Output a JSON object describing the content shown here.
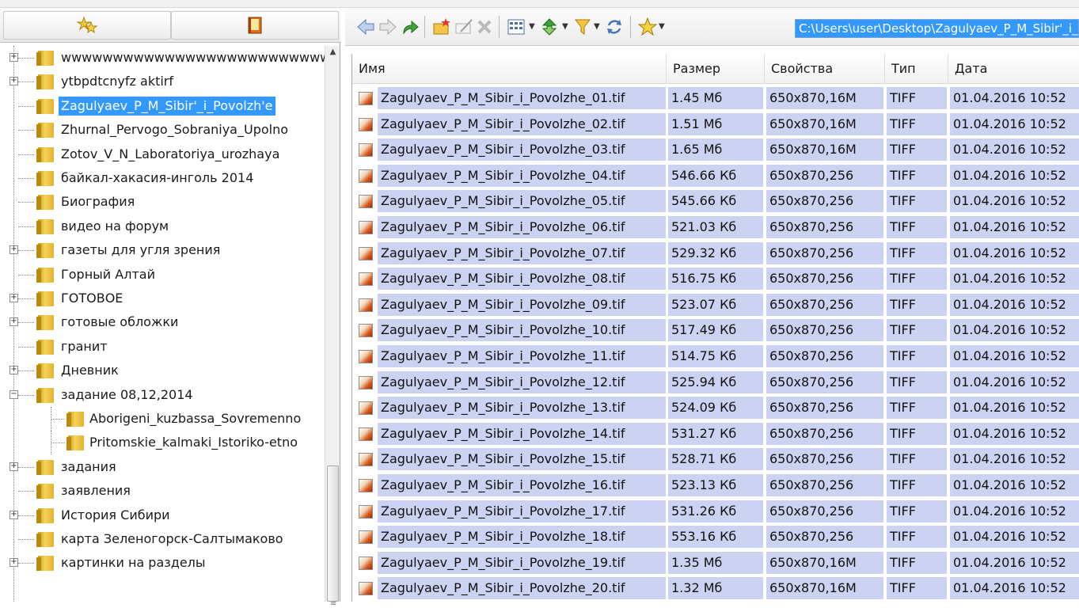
{
  "left_toolbar": {
    "favorites_icon": "stars-icon",
    "bookmarks_icon": "book-icon"
  },
  "tree": {
    "items": [
      {
        "label": "wwwwwwwwwwwwwwwwwwwwwwwwww",
        "expandable": true
      },
      {
        "label": "ytbpdtcnyfz aktirf",
        "expandable": true
      },
      {
        "label": "Zagulyaev_P_M_Sibir'_i_Povolzh'e",
        "expandable": false,
        "selected": true
      },
      {
        "label": "Zhurnal_Pervogo_Sobraniya_Upolno",
        "expandable": false
      },
      {
        "label": "Zotov_V_N_Laboratoriya_urozhaya",
        "expandable": false
      },
      {
        "label": "байкал-хакасия-инголь 2014",
        "expandable": false
      },
      {
        "label": "Биография",
        "expandable": false
      },
      {
        "label": "видео на форум",
        "expandable": false
      },
      {
        "label": "газеты для угля зрения",
        "expandable": true
      },
      {
        "label": "Горный Алтай",
        "expandable": false
      },
      {
        "label": "ГОТОВОЕ",
        "expandable": true
      },
      {
        "label": "готовые обложки",
        "expandable": true
      },
      {
        "label": "гранит",
        "expandable": false
      },
      {
        "label": "Дневник",
        "expandable": true
      },
      {
        "label": "задание 08,12,2014",
        "expandable": true,
        "expanded": true
      },
      {
        "label": "Aborigeni_kuzbassa_Sovremenno",
        "child": true
      },
      {
        "label": "Pritomskie_kalmaki_Istoriko-etno",
        "child": true
      },
      {
        "label": "задания",
        "expandable": true
      },
      {
        "label": "заявления",
        "expandable": false
      },
      {
        "label": "История Сибири",
        "expandable": true
      },
      {
        "label": "карта Зеленогорск-Салтымаково",
        "expandable": false
      },
      {
        "label": "картинки на разделы",
        "expandable": true
      }
    ]
  },
  "toolbar": {
    "path": "C:\\Users\\user\\Desktop\\Zagulyaev_P_M_Sibir'_i_Povolzh'e",
    "icons": [
      "back-arrow-icon",
      "forward-arrow-icon",
      "up-folder-icon",
      "new-folder-icon",
      "rename-icon",
      "delete-icon",
      "view-mode-icon",
      "sort-icon",
      "filter-icon",
      "refresh-icon",
      "favorites-star-icon"
    ]
  },
  "columns": {
    "name": "Имя",
    "size": "Размер",
    "props": "Свойства",
    "type": "Тип",
    "date": "Дата"
  },
  "files": [
    {
      "name": "Zagulyaev_P_M_Sibir_i_Povolzhe_01.tif",
      "size": "1.45 Мб",
      "props": "650x870,16M",
      "type": "TIFF",
      "date": "01.04.2016 10:52"
    },
    {
      "name": "Zagulyaev_P_M_Sibir_i_Povolzhe_02.tif",
      "size": "1.51 Мб",
      "props": "650x870,16M",
      "type": "TIFF",
      "date": "01.04.2016 10:52"
    },
    {
      "name": "Zagulyaev_P_M_Sibir_i_Povolzhe_03.tif",
      "size": "1.65 Мб",
      "props": "650x870,16M",
      "type": "TIFF",
      "date": "01.04.2016 10:52"
    },
    {
      "name": "Zagulyaev_P_M_Sibir_i_Povolzhe_04.tif",
      "size": "546.66 Кб",
      "props": "650x870,256",
      "type": "TIFF",
      "date": "01.04.2016 10:52"
    },
    {
      "name": "Zagulyaev_P_M_Sibir_i_Povolzhe_05.tif",
      "size": "545.66 Кб",
      "props": "650x870,256",
      "type": "TIFF",
      "date": "01.04.2016 10:52"
    },
    {
      "name": "Zagulyaev_P_M_Sibir_i_Povolzhe_06.tif",
      "size": "521.03 Кб",
      "props": "650x870,256",
      "type": "TIFF",
      "date": "01.04.2016 10:52"
    },
    {
      "name": "Zagulyaev_P_M_Sibir_i_Povolzhe_07.tif",
      "size": "529.32 Кб",
      "props": "650x870,256",
      "type": "TIFF",
      "date": "01.04.2016 10:52"
    },
    {
      "name": "Zagulyaev_P_M_Sibir_i_Povolzhe_08.tif",
      "size": "516.75 Кб",
      "props": "650x870,256",
      "type": "TIFF",
      "date": "01.04.2016 10:52"
    },
    {
      "name": "Zagulyaev_P_M_Sibir_i_Povolzhe_09.tif",
      "size": "523.07 Кб",
      "props": "650x870,256",
      "type": "TIFF",
      "date": "01.04.2016 10:52"
    },
    {
      "name": "Zagulyaev_P_M_Sibir_i_Povolzhe_10.tif",
      "size": "517.49 Кб",
      "props": "650x870,256",
      "type": "TIFF",
      "date": "01.04.2016 10:52"
    },
    {
      "name": "Zagulyaev_P_M_Sibir_i_Povolzhe_11.tif",
      "size": "514.75 Кб",
      "props": "650x870,256",
      "type": "TIFF",
      "date": "01.04.2016 10:52"
    },
    {
      "name": "Zagulyaev_P_M_Sibir_i_Povolzhe_12.tif",
      "size": "525.94 Кб",
      "props": "650x870,256",
      "type": "TIFF",
      "date": "01.04.2016 10:52"
    },
    {
      "name": "Zagulyaev_P_M_Sibir_i_Povolzhe_13.tif",
      "size": "524.09 Кб",
      "props": "650x870,256",
      "type": "TIFF",
      "date": "01.04.2016 10:52"
    },
    {
      "name": "Zagulyaev_P_M_Sibir_i_Povolzhe_14.tif",
      "size": "531.27 Кб",
      "props": "650x870,256",
      "type": "TIFF",
      "date": "01.04.2016 10:52"
    },
    {
      "name": "Zagulyaev_P_M_Sibir_i_Povolzhe_15.tif",
      "size": "528.71 Кб",
      "props": "650x870,256",
      "type": "TIFF",
      "date": "01.04.2016 10:52"
    },
    {
      "name": "Zagulyaev_P_M_Sibir_i_Povolzhe_16.tif",
      "size": "523.13 Кб",
      "props": "650x870,256",
      "type": "TIFF",
      "date": "01.04.2016 10:52"
    },
    {
      "name": "Zagulyaev_P_M_Sibir_i_Povolzhe_17.tif",
      "size": "531.26 Кб",
      "props": "650x870,256",
      "type": "TIFF",
      "date": "01.04.2016 10:52"
    },
    {
      "name": "Zagulyaev_P_M_Sibir_i_Povolzhe_18.tif",
      "size": "553.16 Кб",
      "props": "650x870,256",
      "type": "TIFF",
      "date": "01.04.2016 10:52"
    },
    {
      "name": "Zagulyaev_P_M_Sibir_i_Povolzhe_19.tif",
      "size": "1.35 Мб",
      "props": "650x870,16M",
      "type": "TIFF",
      "date": "01.04.2016 10:52"
    },
    {
      "name": "Zagulyaev_P_M_Sibir_i_Povolzhe_20.tif",
      "size": "1.32 Мб",
      "props": "650x870,16M",
      "type": "TIFF",
      "date": "01.04.2016 10:52"
    }
  ],
  "colors": {
    "selection": "#3399ff",
    "row_highlight": "#ccd2f1"
  }
}
